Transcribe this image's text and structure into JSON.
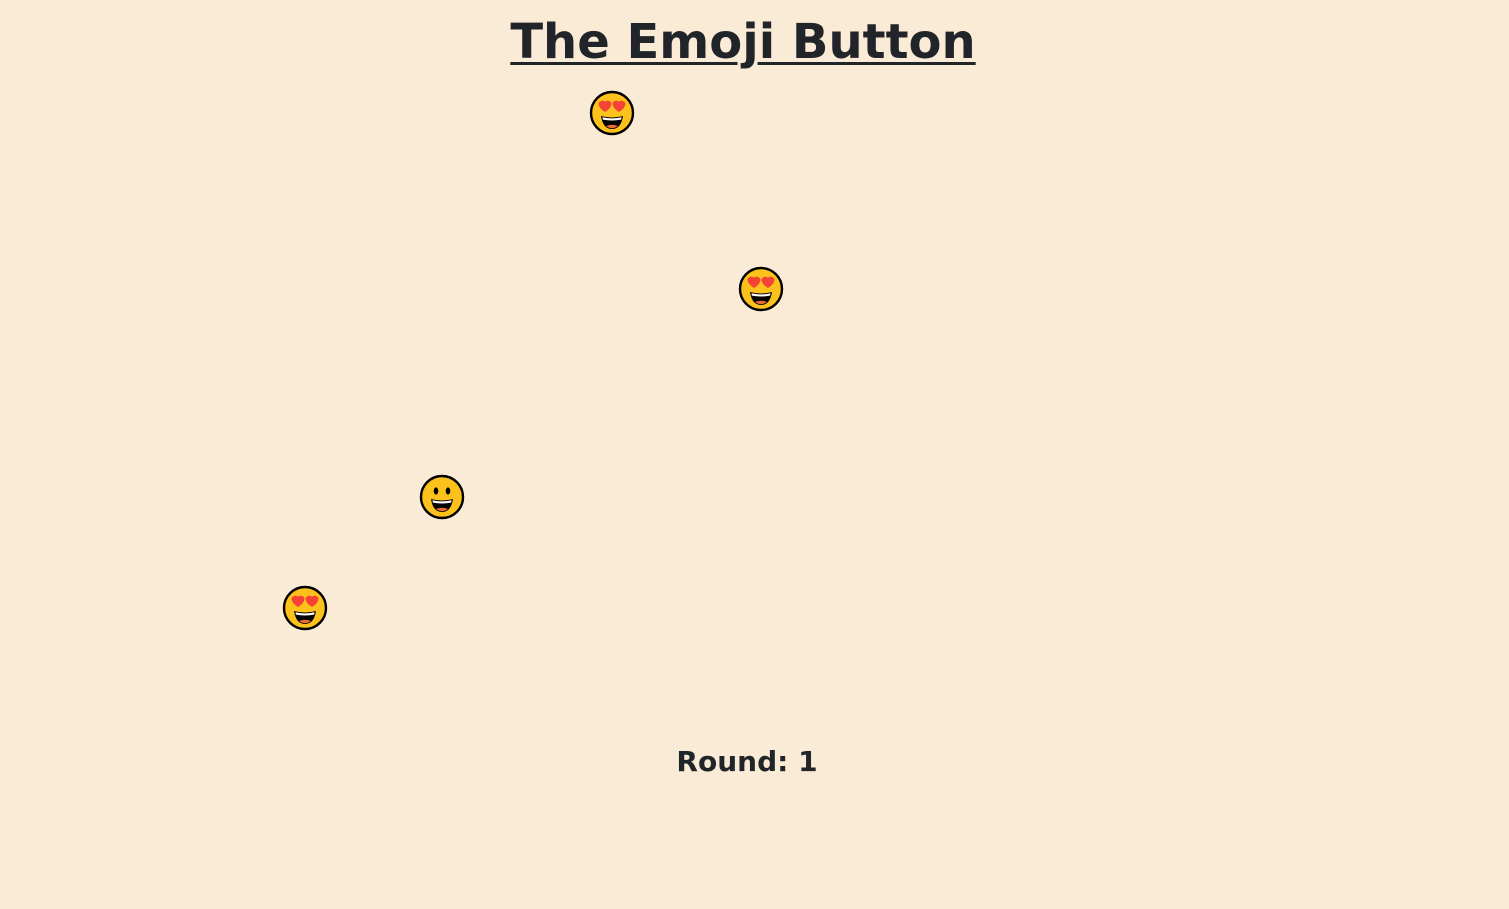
{
  "game": {
    "title": "The Emoji Button",
    "round_label": "Round: 1"
  },
  "emojis": [
    {
      "icon": "heart-eyes-smiley-icon"
    },
    {
      "icon": "heart-eyes-smiley-icon"
    },
    {
      "icon": "grinning-face-icon"
    },
    {
      "icon": "heart-eyes-smiley-icon"
    }
  ],
  "colors": {
    "background": "#faebd7",
    "text": "#212529",
    "face": "#fcc21b",
    "outline": "#000000",
    "heart": "#f44336"
  }
}
